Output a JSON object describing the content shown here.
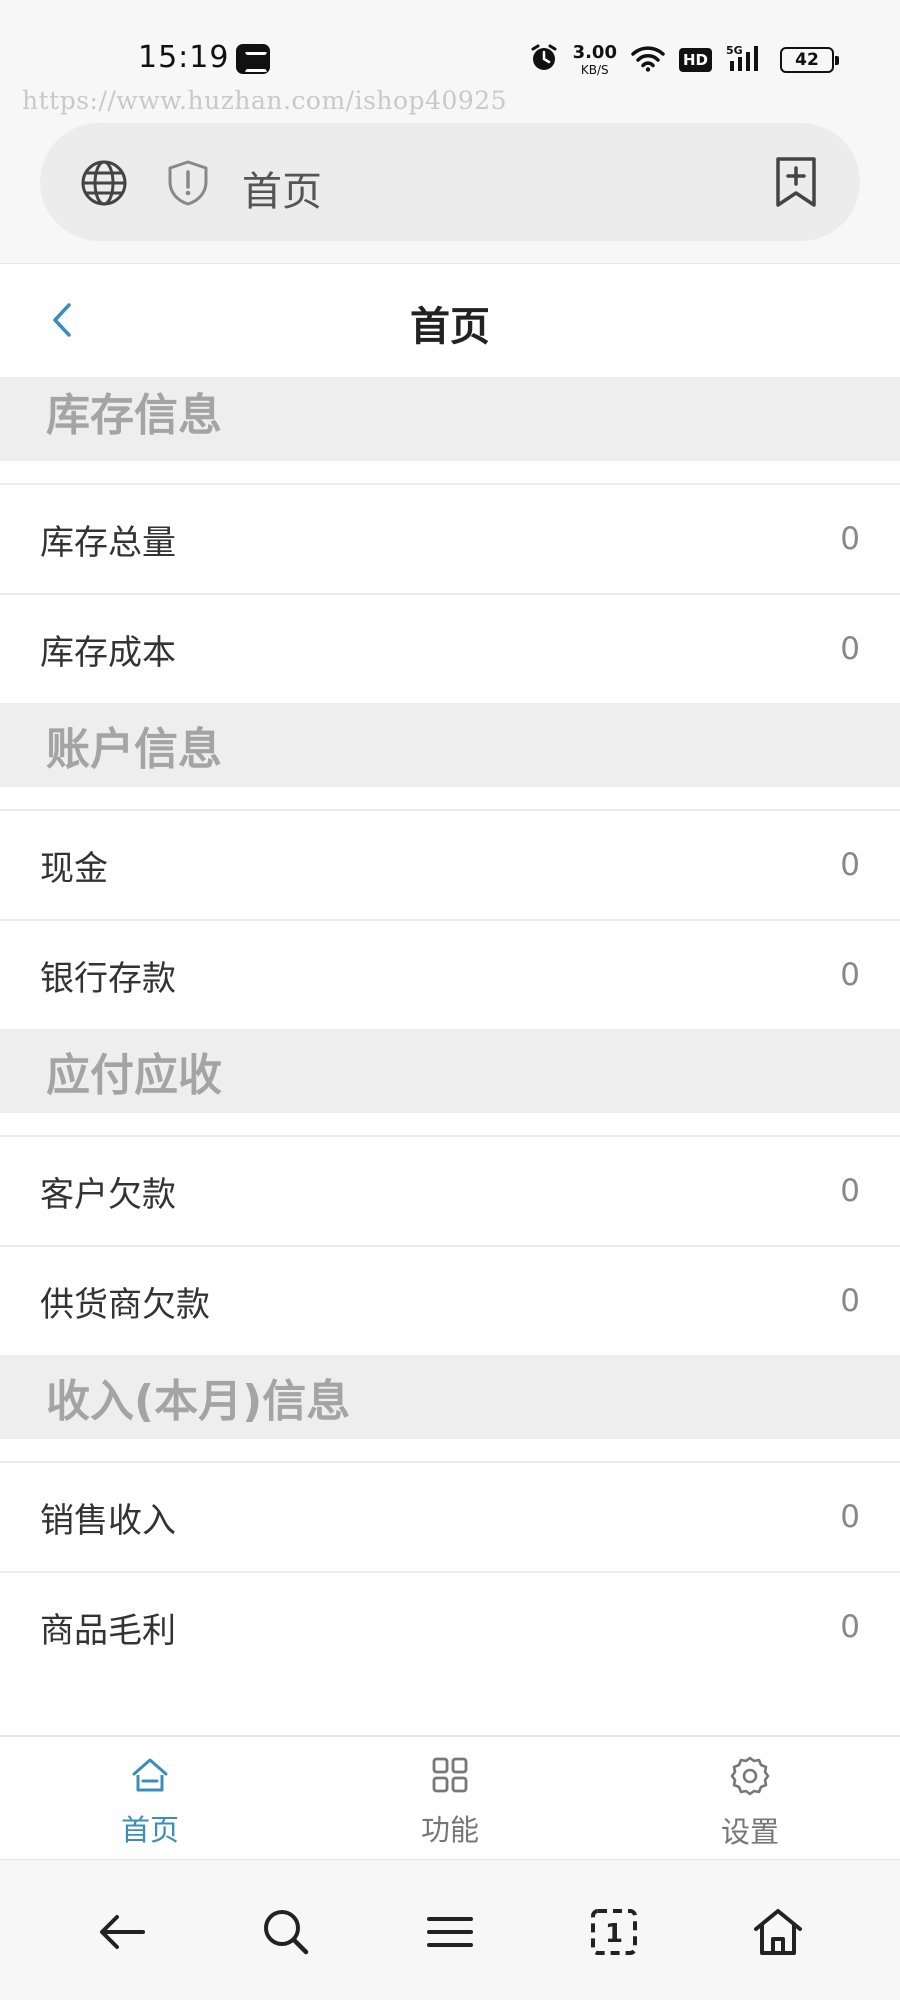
{
  "status_bar": {
    "time": "15:19",
    "net_speed_value": "3.00",
    "net_speed_unit": "KB/S",
    "hd_label": "HD",
    "battery_level": "42",
    "watermark_url": "https://www.huzhan.com/ishop40925"
  },
  "browser": {
    "address_text": "首页"
  },
  "header": {
    "title": "首页"
  },
  "sections": [
    {
      "title": "库存信息",
      "rows": [
        {
          "label": "库存总量",
          "value": "0"
        },
        {
          "label": "库存成本",
          "value": "0"
        }
      ]
    },
    {
      "title": "账户信息",
      "rows": [
        {
          "label": "现金",
          "value": "0"
        },
        {
          "label": "银行存款",
          "value": "0"
        }
      ]
    },
    {
      "title": "应付应收",
      "rows": [
        {
          "label": "客户欠款",
          "value": "0"
        },
        {
          "label": "供货商欠款",
          "value": "0"
        }
      ]
    },
    {
      "title": "收入(本月)信息",
      "rows": [
        {
          "label": "销售收入",
          "value": "0"
        },
        {
          "label": "商品毛利",
          "value": "0"
        }
      ]
    }
  ],
  "tabs": [
    {
      "label": "首页",
      "icon": "home-icon",
      "active": true
    },
    {
      "label": "功能",
      "icon": "grid-icon",
      "active": false
    },
    {
      "label": "设置",
      "icon": "gear-icon",
      "active": false
    }
  ],
  "system_nav": {
    "tab_count": "1"
  },
  "colors": {
    "accent": "#3b8cbf",
    "section_bg": "#eeeeee",
    "section_text": "#a4a4a4"
  }
}
